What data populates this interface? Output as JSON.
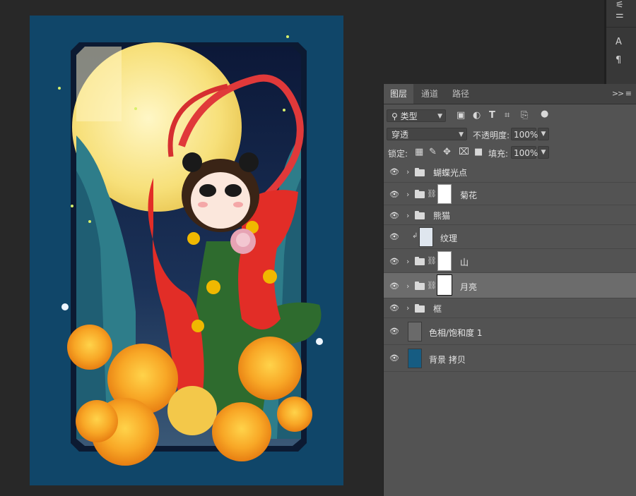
{
  "tabs": [
    {
      "label": "图层"
    },
    {
      "label": "通道"
    },
    {
      "label": "路径"
    }
  ],
  "filter": {
    "label": "类型"
  },
  "blend_mode": {
    "value": "穿透"
  },
  "opacity": {
    "label": "不透明度:",
    "value": "100%"
  },
  "lock": {
    "label": "锁定:"
  },
  "fill": {
    "label": "填充:",
    "value": "100%"
  },
  "layers": [
    {
      "name": "蝴蝶光点",
      "type": "group"
    },
    {
      "name": "菊花",
      "type": "group-mask"
    },
    {
      "name": "熊猫",
      "type": "group"
    },
    {
      "name": "纹理",
      "type": "clipped"
    },
    {
      "name": "山",
      "type": "group-mask"
    },
    {
      "name": "月亮",
      "type": "group-mask",
      "selected": true
    },
    {
      "name": "框",
      "type": "group"
    },
    {
      "name": "色相/饱和度 1",
      "type": "adjustment"
    },
    {
      "name": "背景 拷贝",
      "type": "layer"
    }
  ],
  "colors": {
    "app_bg": "#282828",
    "panel_bg": "#535353",
    "selected_row": "#6c6c6c",
    "poster_border": "#124a6e",
    "background_copy_thumb": "#165c82"
  },
  "icons": [
    "filter-image-icon",
    "filter-adjust-icon",
    "filter-type-icon",
    "filter-shape-icon",
    "filter-smart-icon",
    "filter-toggle-icon",
    "eye-icon",
    "folder-icon",
    "link-icon",
    "lock-pixels-icon",
    "lock-brush-icon",
    "lock-move-icon",
    "lock-artboard-icon",
    "lock-all-icon"
  ]
}
